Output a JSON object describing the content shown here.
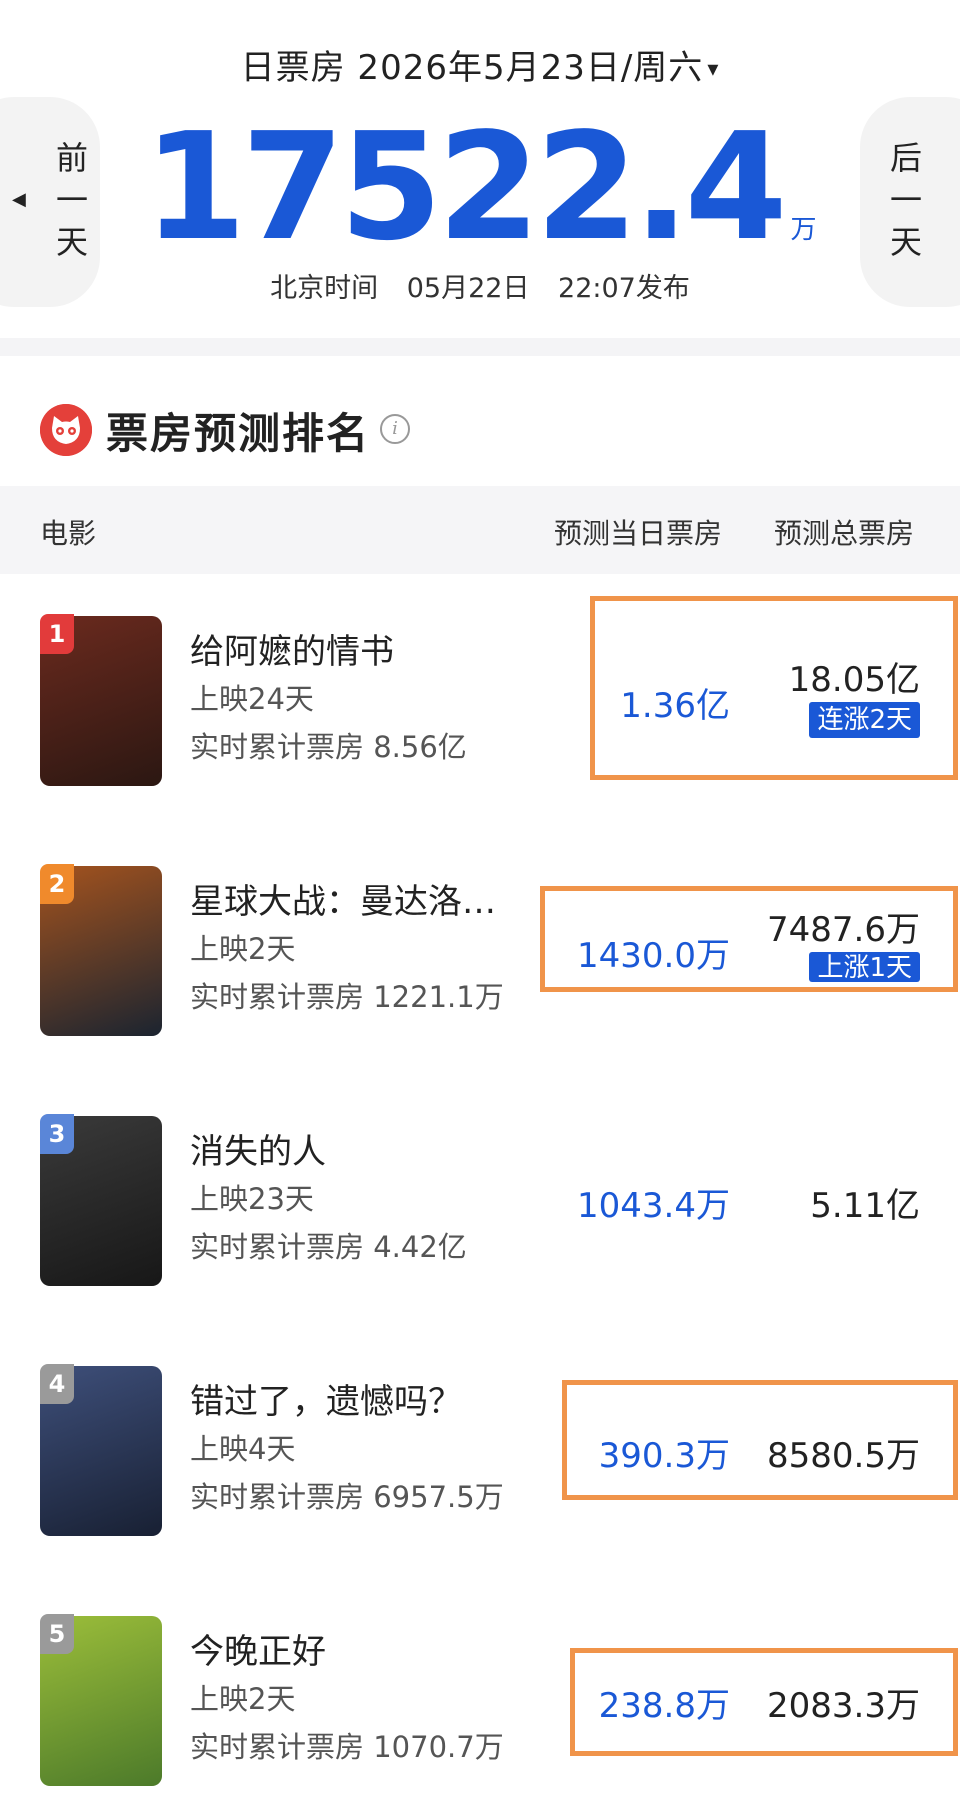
{
  "header": {
    "date_text": "日票房 2026年5月23日/周六",
    "dropdown_arrow": "▾",
    "prev_label": "前一天",
    "next_label": "后一天",
    "total_value": "17522.4",
    "total_unit": "万",
    "publish_label": "北京时间",
    "publish_date": "05月22日",
    "publish_time": "22:07发布"
  },
  "section": {
    "title": "票房预测排名",
    "logo_icon": "maoyan-cat-icon",
    "info_icon": "info-icon",
    "info_glyph": "i"
  },
  "table_header": {
    "movie": "电影",
    "daily": "预测当日票房",
    "total": "预测总票房"
  },
  "movies": [
    {
      "rank": "1",
      "title": "给阿嬷的情书",
      "days": "上映24天",
      "cumulative": "实时累计票房 8.56亿",
      "daily": "1.36亿",
      "total": "18.05亿",
      "badge": "连涨2天",
      "rank_color": "#e23b3b",
      "poster_colors": [
        "#6b2a1e",
        "#2b1712"
      ]
    },
    {
      "rank": "2",
      "title": "星球大战：曼达洛…",
      "days": "上映2天",
      "cumulative": "实时累计票房 1221.1万",
      "daily": "1430.0万",
      "total": "7487.6万",
      "badge": "上涨1天",
      "rank_color": "#f08a2c",
      "poster_colors": [
        "#a4531e",
        "#1b2430"
      ]
    },
    {
      "rank": "3",
      "title": "消失的人",
      "days": "上映23天",
      "cumulative": "实时累计票房 4.42亿",
      "daily": "1043.4万",
      "total": "5.11亿",
      "badge": "",
      "rank_color": "#5a86d8",
      "poster_colors": [
        "#3a3a3a",
        "#171717"
      ]
    },
    {
      "rank": "4",
      "title": "错过了，遗憾吗？",
      "days": "上映4天",
      "cumulative": "实时累计票房 6957.5万",
      "daily": "390.3万",
      "total": "8580.5万",
      "badge": "",
      "rank_color": "#9a9a9a",
      "poster_colors": [
        "#3e4f7a",
        "#182033"
      ]
    },
    {
      "rank": "5",
      "title": "今晚正好",
      "days": "上映2天",
      "cumulative": "实时累计票房 1070.7万",
      "daily": "238.8万",
      "total": "2083.3万",
      "badge": "",
      "rank_color": "#9a9a9a",
      "poster_colors": [
        "#9cbe3a",
        "#4c7a2a"
      ]
    }
  ],
  "colors": {
    "accent_blue": "#1a58d6",
    "highlight_orange": "#f0944a",
    "logo_red": "#e4403a"
  }
}
